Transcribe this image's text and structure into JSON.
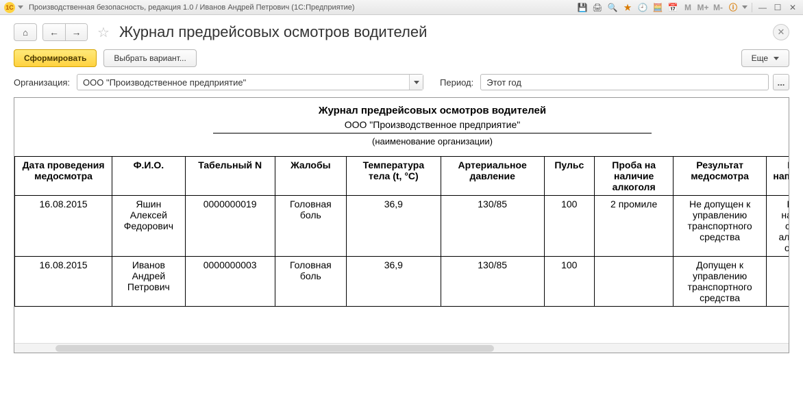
{
  "window": {
    "title": "Производственная безопасность, редакция 1.0 / Иванов Андрей Петрович  (1С:Предприятие)",
    "app_icon_text": "1C"
  },
  "titlebar_icons": {
    "save": "💾",
    "print": "🖨",
    "preview": "🔍",
    "favorite": "★",
    "history": "🕘",
    "calc": "🧮",
    "calendar": "📅",
    "m": "M",
    "mplus": "M+",
    "mminus": "M-",
    "info": "ⓘ",
    "minimize": "—",
    "maximize": "☐",
    "close": "✕"
  },
  "page": {
    "title": "Журнал предрейсовых осмотров водителей",
    "home_icon": "⌂",
    "back_icon": "←",
    "fwd_icon": "→",
    "star": "☆",
    "close": "✕"
  },
  "toolbar": {
    "form_btn": "Сформировать",
    "variant_btn": "Выбрать вариант...",
    "more_btn": "Еще"
  },
  "filters": {
    "org_label": "Организация:",
    "org_value": "ООО \"Производственное предприятие\"",
    "period_label": "Период:",
    "period_value": "Этот год",
    "ellipsis": "..."
  },
  "report": {
    "title": "Журнал предрейсовых осмотров водителей",
    "subtitle": "ООО \"Производственное предприятие\"",
    "caption": "(наименование организации)",
    "columns": [
      "Дата проведения медосмотра",
      "Ф.И.О.",
      "Табельный N",
      "Жалобы",
      "Температура тела (t, °С)",
      "Артериальное давление",
      "Пульс",
      "Проба на наличие алкоголя",
      "Результат медосмотра",
      "Причина направления к врачу"
    ],
    "rows": [
      {
        "date": "16.08.2015",
        "fio": "Яшин Алексей Федорович",
        "tab_n": "0000000019",
        "complaint": "Головная боль",
        "temp": "36,9",
        "pressure": "130/85",
        "pulse": "100",
        "alcohol": "2 промиле",
        "result": "Не допущен к управлению транспортного средства",
        "reason": "Водитель находится в состоянии алкогольного опьянения"
      },
      {
        "date": "16.08.2015",
        "fio": "Иванов Андрей Петрович",
        "tab_n": "0000000003",
        "complaint": "Головная боль",
        "temp": "36,9",
        "pressure": "130/85",
        "pulse": "100",
        "alcohol": "",
        "result": "Допущен к управлению транспортного средства",
        "reason": "-"
      }
    ]
  }
}
